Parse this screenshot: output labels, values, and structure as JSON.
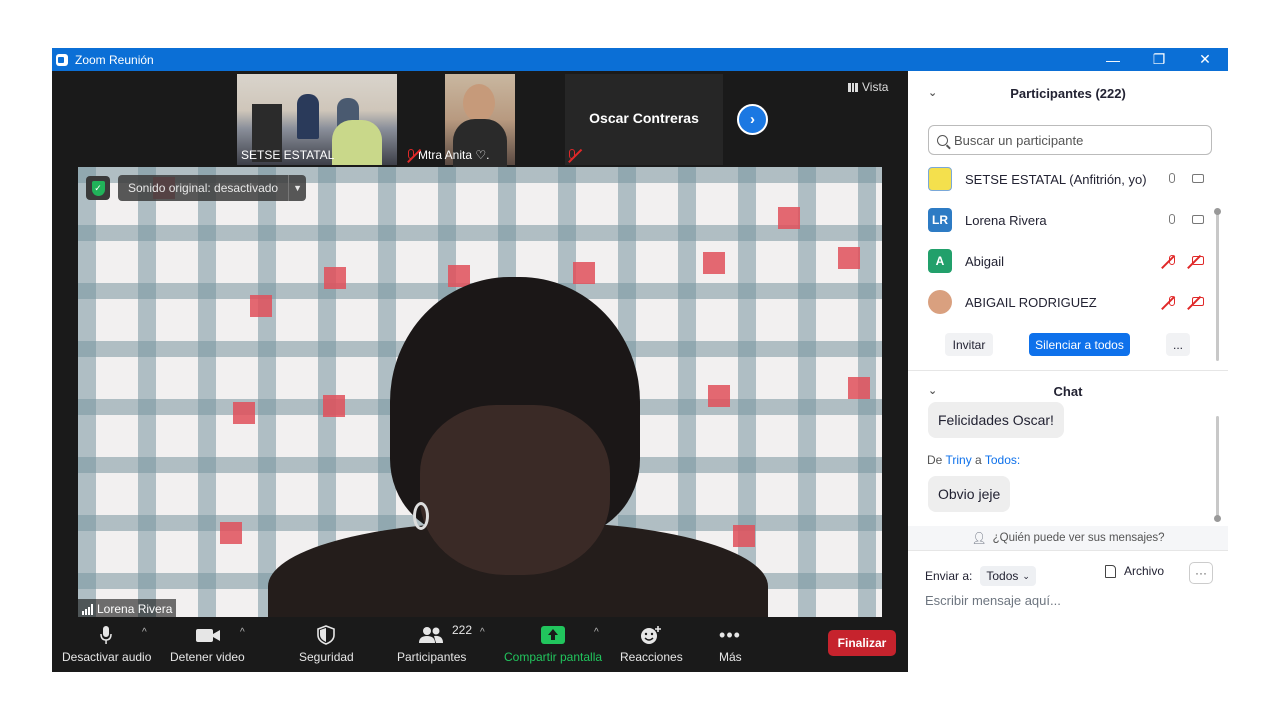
{
  "window": {
    "title": "Zoom Reunión",
    "minimize": "—",
    "restore": "❐",
    "close": "✕"
  },
  "thumbnails": [
    {
      "name": "SETSE ESTATAL",
      "muted": false
    },
    {
      "name": "Mtra Anita ♡.",
      "muted": true
    },
    {
      "name": "Oscar Contreras",
      "muted": true
    }
  ],
  "view_button": "Vista",
  "main_video": {
    "speaker": "Lorena Rivera",
    "original_sound": "Sonido original: desactivado"
  },
  "toolbar": {
    "mute": "Desactivar audio",
    "video": "Detener video",
    "security": "Seguridad",
    "participants": "Participantes",
    "participant_count": "222",
    "share": "Compartir pantalla",
    "reactions": "Reacciones",
    "more": "Más",
    "end": "Finalizar"
  },
  "participants_panel": {
    "title": "Participantes (222)",
    "search_placeholder": "Buscar un participante",
    "items": [
      {
        "name": "SETSE ESTATAL (Anfitrión, yo)",
        "initials": "",
        "color": "#f4e04d",
        "mic_on": true,
        "cam_on": true
      },
      {
        "name": "Lorena Rivera",
        "initials": "LR",
        "color": "#2d7bc4",
        "mic_on": true,
        "cam_on": true
      },
      {
        "name": "Abigail",
        "initials": "A",
        "color": "#22a06b",
        "mic_on": false,
        "cam_on": false
      },
      {
        "name": "ABIGAIL RODRIGUEZ",
        "initials": "",
        "color": "#d9a07f",
        "mic_on": false,
        "cam_on": false
      }
    ],
    "invite": "Invitar",
    "mute_all": "Silenciar a todos",
    "more": "..."
  },
  "chat": {
    "title": "Chat",
    "messages": [
      {
        "text": "Felicidades Oscar!"
      },
      {
        "from_prefix": "De",
        "sender": "Triny",
        "to_word": "a",
        "recipient": "Todos:",
        "text": "Obvio jeje"
      }
    ],
    "who_can_see": "¿Quién puede ver sus mensajes?",
    "send_to_label": "Enviar a:",
    "send_to_value": "Todos",
    "file": "Archivo",
    "more": "···",
    "input_placeholder": "Escribir mensaje aquí..."
  },
  "colors": {
    "titlebar": "#0b6fd6",
    "accent": "#0e71eb",
    "end": "#c6232d",
    "share": "#21c55d"
  }
}
